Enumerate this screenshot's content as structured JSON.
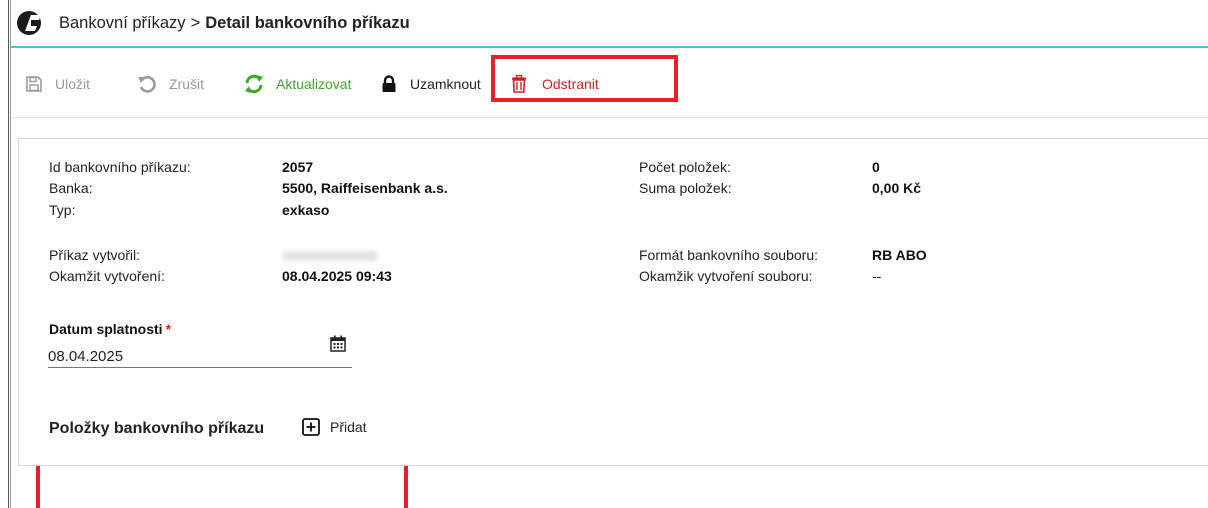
{
  "header": {
    "breadcrumb_parent": "Bankovní příkazy",
    "breadcrumb_separator": ">",
    "breadcrumb_current": "Detail bankovního příkazu"
  },
  "toolbar": {
    "save_label": "Uložit",
    "cancel_label": "Zrušit",
    "refresh_label": "Aktualizovat",
    "lock_label": "Uzamknout",
    "delete_label": "Odstranit"
  },
  "details": {
    "id_label": "Id bankovního příkazu:",
    "id_value": "2057",
    "bank_label": "Banka:",
    "bank_value": "5500, Raiffeisenbank a.s.",
    "type_label": "Typ:",
    "type_value": "exkaso",
    "created_by_label": "Příkaz vytvořil:",
    "created_at_label": "Okamžit vytvoření:",
    "created_at_value": "08.04.2025 09:43",
    "item_count_label": "Počet položek:",
    "item_count_value": "0",
    "item_sum_label": "Suma položek:",
    "item_sum_value": "0,00 Kč",
    "file_format_label": "Formát bankovního souboru:",
    "file_format_value": "RB ABO",
    "file_created_label": "Okamžik vytvoření souboru:",
    "file_created_value": "--"
  },
  "due_date": {
    "label": "Datum splatnosti",
    "required_mark": "*",
    "value": "08.04.2025"
  },
  "items_section": {
    "title": "Položky bankovního příkazu",
    "add_label": "Přidat"
  },
  "colors": {
    "accent_line": "#4cc1d4",
    "refresh_green": "#3ea628",
    "delete_red": "#cc2222",
    "highlight_red": "#e8202a",
    "disabled_gray": "#999999"
  }
}
